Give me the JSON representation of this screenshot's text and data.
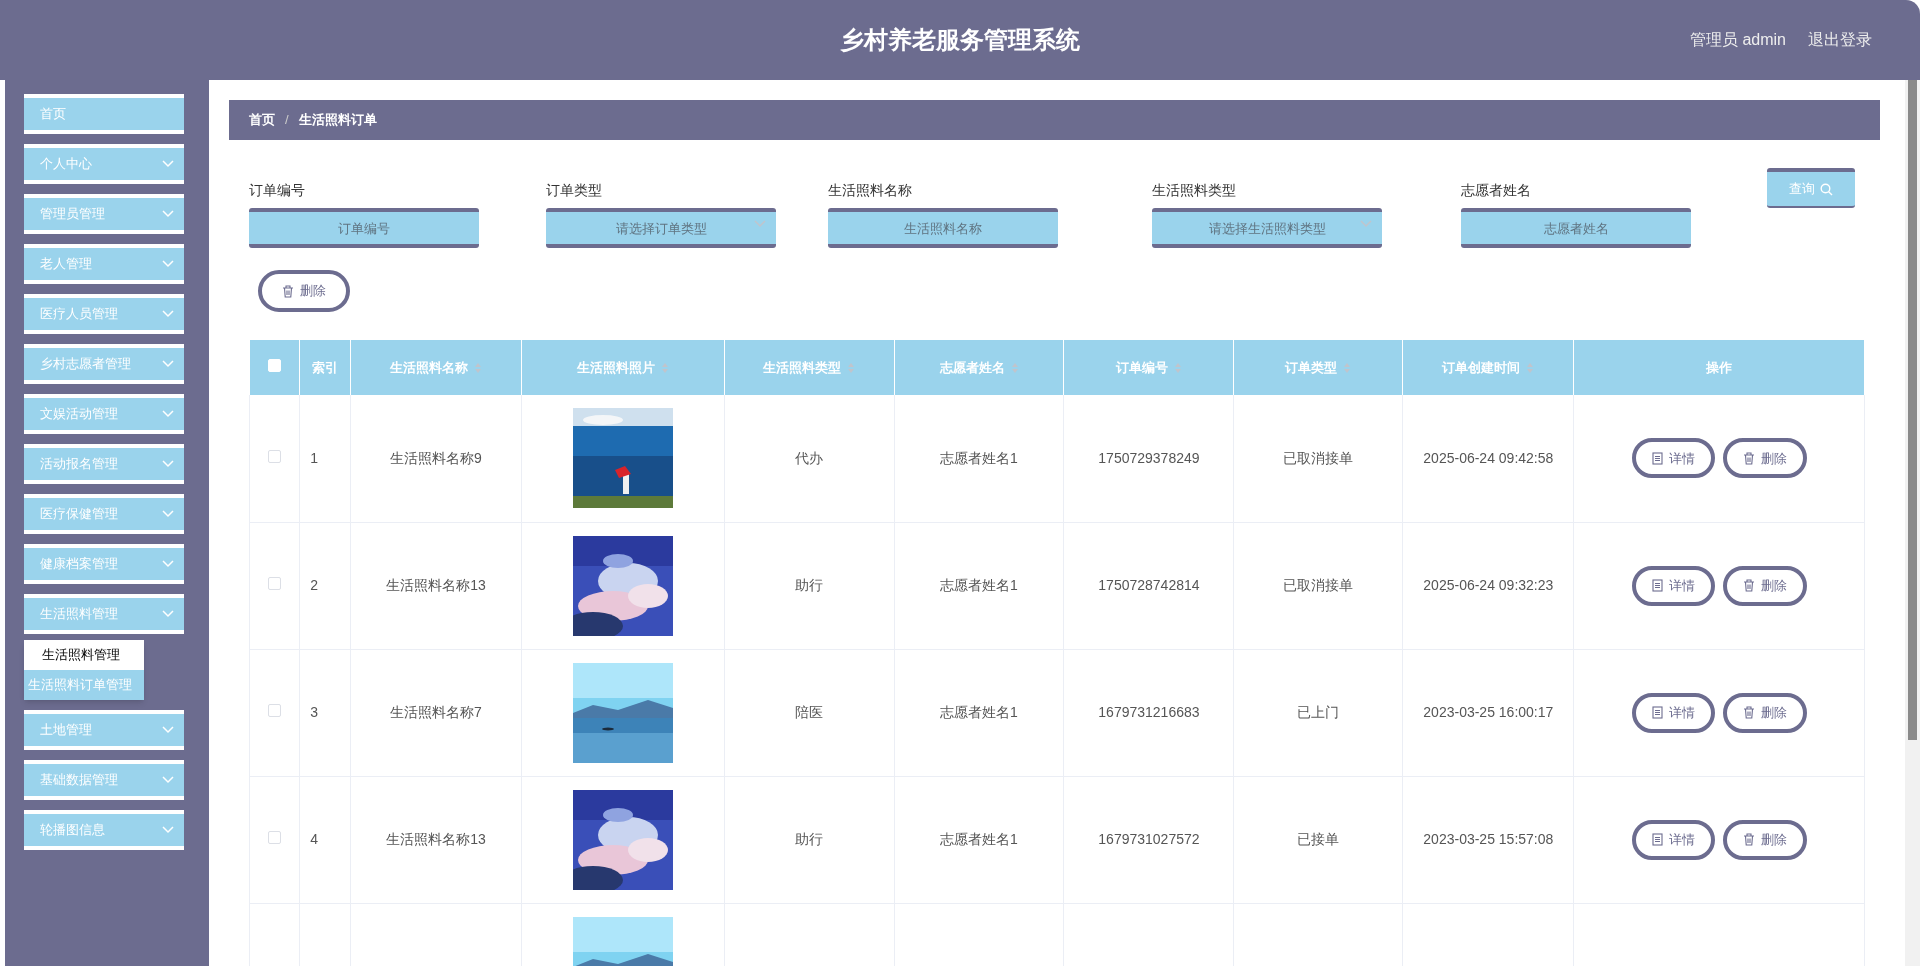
{
  "header": {
    "title": "乡村养老服务管理系统",
    "user": "管理员 admin",
    "logout": "退出登录"
  },
  "sidebar": {
    "items": [
      {
        "label": "首页",
        "expandable": false
      },
      {
        "label": "个人中心",
        "expandable": true
      },
      {
        "label": "管理员管理",
        "expandable": true
      },
      {
        "label": "老人管理",
        "expandable": true
      },
      {
        "label": "医疗人员管理",
        "expandable": true
      },
      {
        "label": "乡村志愿者管理",
        "expandable": true
      },
      {
        "label": "文娱活动管理",
        "expandable": true
      },
      {
        "label": "活动报名管理",
        "expandable": true
      },
      {
        "label": "医疗保健管理",
        "expandable": true
      },
      {
        "label": "健康档案管理",
        "expandable": true
      },
      {
        "label": "生活照料管理",
        "expandable": true,
        "children": [
          {
            "label": "生活照料管理",
            "hovered": true
          },
          {
            "label": "生活照料订单管理",
            "hovered": false
          }
        ]
      },
      {
        "label": "土地管理",
        "expandable": true
      },
      {
        "label": "基础数据管理",
        "expandable": true
      },
      {
        "label": "轮播图信息",
        "expandable": true
      }
    ]
  },
  "breadcrumb": [
    "首页",
    "/",
    "生活照料订单"
  ],
  "filters": [
    {
      "label": "订单编号",
      "placeholder": "订单编号",
      "kind": "text"
    },
    {
      "label": "订单类型",
      "placeholder": "请选择订单类型",
      "kind": "select"
    },
    {
      "label": "生活照料名称",
      "placeholder": "生活照料名称",
      "kind": "text"
    },
    {
      "label": "生活照料类型",
      "placeholder": "请选择生活照料类型",
      "kind": "select"
    },
    {
      "label": "志愿者姓名",
      "placeholder": "志愿者姓名",
      "kind": "text"
    }
  ],
  "query_button": "查询",
  "delete_button": "删除",
  "table": {
    "columns": [
      {
        "kind": "checkbox",
        "checked": false
      },
      {
        "label": "索引",
        "sortable": false
      },
      {
        "label": "生活照料名称",
        "sortable": true
      },
      {
        "label": "生活照料照片",
        "sortable": true
      },
      {
        "label": "生活照料类型",
        "sortable": true
      },
      {
        "label": "志愿者姓名",
        "sortable": true
      },
      {
        "label": "订单编号",
        "sortable": true
      },
      {
        "label": "订单类型",
        "sortable": true
      },
      {
        "label": "订单创建时间",
        "sortable": true
      },
      {
        "label": "操作",
        "sortable": false
      }
    ],
    "rows": [
      {
        "checked": false,
        "index": "1",
        "name": "生活照料名称9",
        "photo": {
          "kind": "picture"
        },
        "type": "代办",
        "volunteer": "志愿者姓名1",
        "order_no": "1750729378249",
        "order_type": "已取消接单",
        "created": "2025-06-24 09:42:58",
        "actions": [
          "详情",
          "删除"
        ]
      },
      {
        "checked": false,
        "index": "2",
        "name": "生活照料名称13",
        "photo": {
          "kind": "picture"
        },
        "type": "助行",
        "volunteer": "志愿者姓名1",
        "order_no": "1750728742814",
        "order_type": "已取消接单",
        "created": "2025-06-24 09:32:23",
        "actions": [
          "详情",
          "删除"
        ]
      },
      {
        "checked": false,
        "index": "3",
        "name": "生活照料名称7",
        "photo": {
          "kind": "picture"
        },
        "type": "陪医",
        "volunteer": "志愿者姓名1",
        "order_no": "1679731216683",
        "order_type": "已上门",
        "created": "2023-03-25 16:00:17",
        "actions": [
          "详情",
          "删除"
        ]
      },
      {
        "checked": false,
        "index": "4",
        "name": "生活照料名称13",
        "photo": {
          "kind": "picture"
        },
        "type": "助行",
        "volunteer": "志愿者姓名1",
        "order_no": "1679731027572",
        "order_type": "已接单",
        "created": "2023-03-25 15:57:08",
        "actions": [
          "详情",
          "删除"
        ]
      },
      {
        "photo": {
          "kind": "picture"
        }
      }
    ]
  }
}
